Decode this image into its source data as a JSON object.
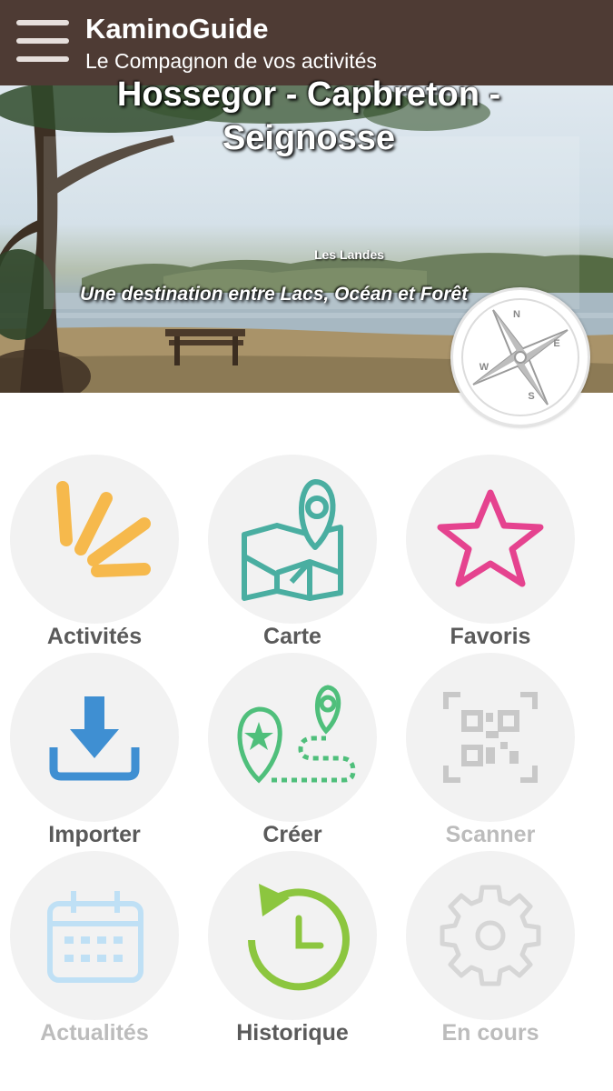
{
  "appbar": {
    "title": "KaminoGuide",
    "subtitle": "Le Compagnon de vos activités",
    "background": "#4e3b34"
  },
  "hero": {
    "title": "Hossegor - Capbreton -Seignosse",
    "region": "Les Landes",
    "tagline": "Une destination entre  Lacs, Océan et Forêt"
  },
  "compass": {
    "icon": "compass-icon",
    "letters": [
      "N",
      "E",
      "S",
      "W"
    ]
  },
  "tiles": [
    {
      "label": "Activités",
      "icon": "activities-burst-icon",
      "color": "#f6b94c",
      "enabled": true
    },
    {
      "label": "Carte",
      "icon": "map-pin-icon",
      "color": "#4aaea1",
      "enabled": true
    },
    {
      "label": "Favoris",
      "icon": "star-icon",
      "color": "#e5438f",
      "enabled": true
    },
    {
      "label": "Importer",
      "icon": "download-icon",
      "color": "#3f8fd2",
      "enabled": true
    },
    {
      "label": "Créer",
      "icon": "route-create-icon",
      "color": "#4fbf7b",
      "enabled": true
    },
    {
      "label": "Scanner",
      "icon": "qr-code-icon",
      "color": "#c8c8c8",
      "enabled": false
    },
    {
      "label": "Actualités",
      "icon": "calendar-icon",
      "color": "#bfe0f5",
      "enabled": false
    },
    {
      "label": "Historique",
      "icon": "history-icon",
      "color": "#8cc63f",
      "enabled": true
    },
    {
      "label": "En cours",
      "icon": "gear-icon",
      "color": "#d6d6d6",
      "enabled": false
    }
  ]
}
